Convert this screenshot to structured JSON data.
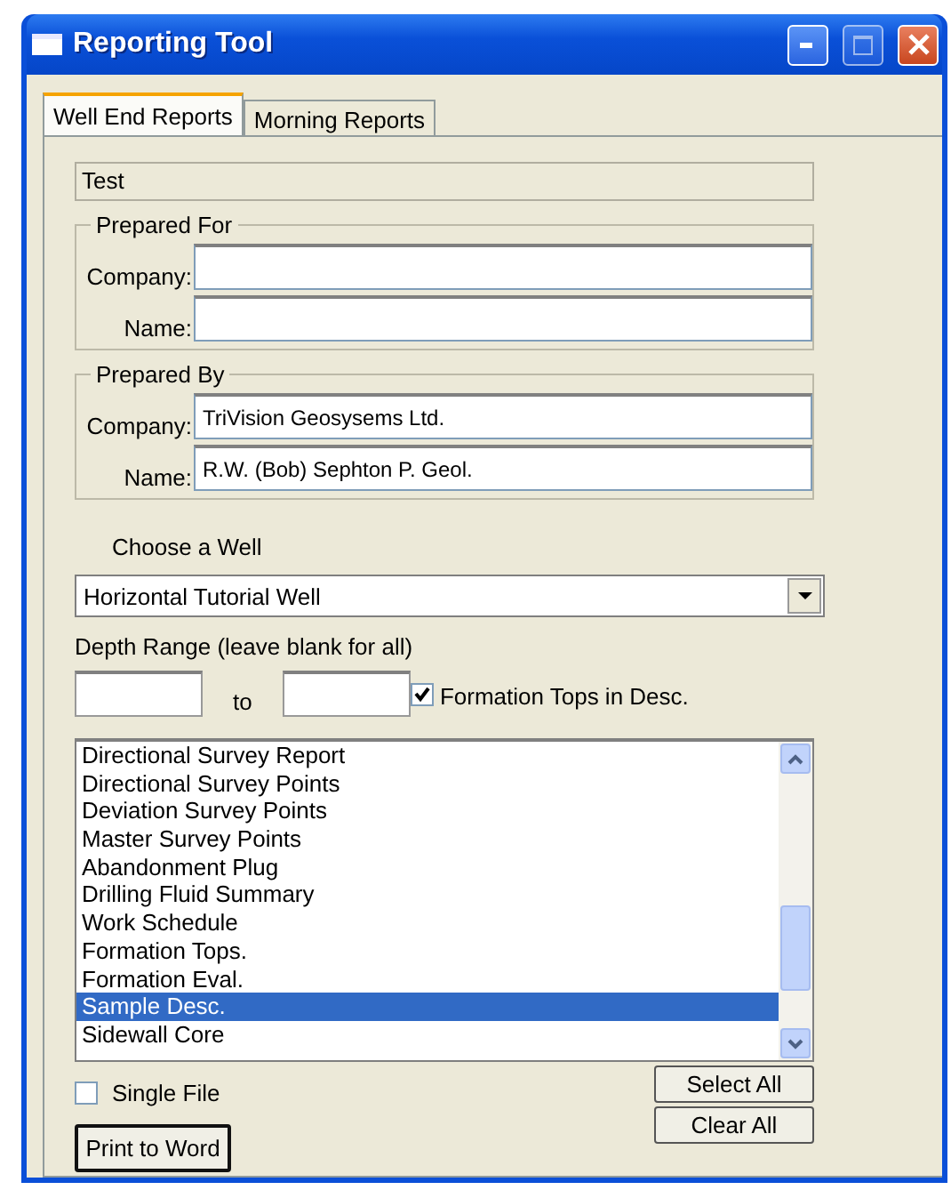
{
  "window": {
    "title": "Reporting Tool"
  },
  "tabs": [
    {
      "label": "Well End Reports",
      "selected": true
    },
    {
      "label": "Morning Reports",
      "selected": false
    }
  ],
  "title_field": {
    "value": "Test"
  },
  "prepared_for": {
    "legend": "Prepared For",
    "fields": [
      {
        "label": "Company:"
      },
      {
        "label": "Name:"
      }
    ]
  },
  "prepared_by": {
    "legend": "Prepared By",
    "fields": [
      {
        "label": "Company:",
        "value": "TriVision Geosysems Ltd."
      },
      {
        "label": "Name:",
        "value": "R.W. (Bob) Sephton P. Geol."
      }
    ]
  },
  "well": {
    "label": "Choose a Well",
    "value": "Horizontal Tutorial Well"
  },
  "depth": {
    "label": "Depth Range (leave blank for all)",
    "separator": "to"
  },
  "formation_tops": {
    "label": "Formation Tops in Desc.",
    "checked": true
  },
  "reports": [
    {
      "label": "Directional Survey Report",
      "selected": false
    },
    {
      "label": "Directional Survey Points",
      "selected": false
    },
    {
      "label": "Deviation Survey Points",
      "selected": false
    },
    {
      "label": "Master Survey Points",
      "selected": false
    },
    {
      "label": "Abandonment Plug",
      "selected": false
    },
    {
      "label": "Drilling Fluid Summary",
      "selected": false
    },
    {
      "label": "Work Schedule",
      "selected": false
    },
    {
      "label": "Formation Tops.",
      "selected": false
    },
    {
      "label": "Formation Eval.",
      "selected": false
    },
    {
      "label": "Sample Desc.",
      "selected": true
    },
    {
      "label": "Sidewall Core",
      "selected": false
    }
  ],
  "single_file": {
    "label": "Single File",
    "checked": false
  },
  "buttons": {
    "print": "Print to Word",
    "select_all": "Select All",
    "clear_all": "Clear All"
  }
}
